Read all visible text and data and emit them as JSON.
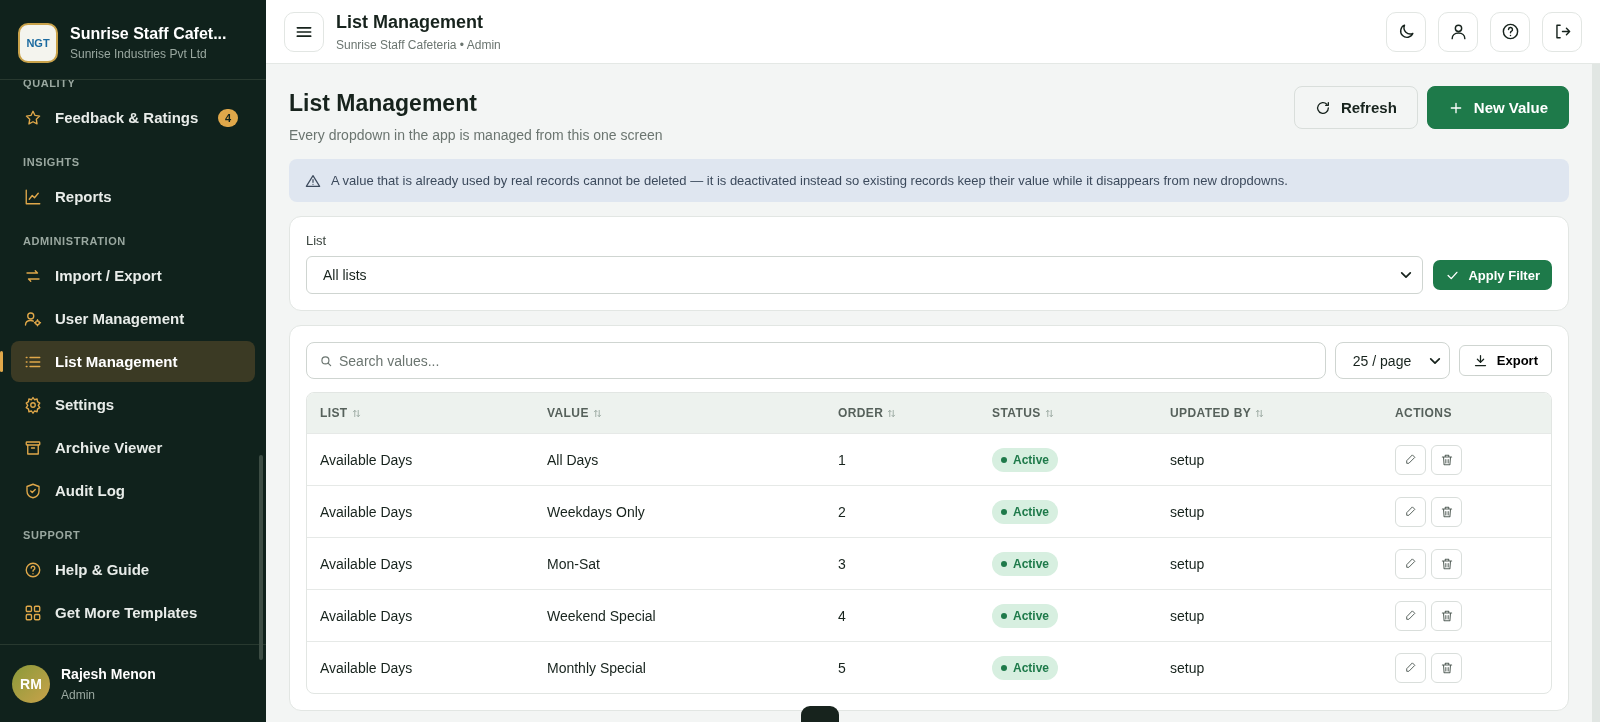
{
  "sidebar": {
    "brand": {
      "logo": "NGT",
      "title": "Sunrise Staff Cafet...",
      "subtitle": "Sunrise Industries Pvt Ltd"
    },
    "sections": [
      {
        "heading": "QUALITY",
        "items": [
          {
            "label": "Feedback & Ratings",
            "badge": "4",
            "selected": false
          }
        ]
      },
      {
        "heading": "INSIGHTS",
        "items": [
          {
            "label": "Reports",
            "selected": false
          }
        ]
      },
      {
        "heading": "ADMINISTRATION",
        "items": [
          {
            "label": "Import / Export",
            "selected": false
          },
          {
            "label": "User Management",
            "selected": false
          },
          {
            "label": "List Management",
            "selected": true
          },
          {
            "label": "Settings",
            "selected": false
          },
          {
            "label": "Archive Viewer",
            "selected": false
          },
          {
            "label": "Audit Log",
            "selected": false
          }
        ]
      },
      {
        "heading": "SUPPORT",
        "items": [
          {
            "label": "Help & Guide",
            "selected": false
          },
          {
            "label": "Get More Templates",
            "selected": false
          }
        ]
      }
    ],
    "user": {
      "initials": "RM",
      "name": "Rajesh Menon",
      "role": "Admin"
    }
  },
  "topbar": {
    "title": "List Management",
    "subtitle": "Sunrise Staff Cafeteria • Admin"
  },
  "page": {
    "title": "List Management",
    "subtitle": "Every dropdown in the app is managed from this one screen",
    "buttons": [
      {
        "kind": "secondary",
        "label": "Refresh"
      },
      {
        "kind": "primary",
        "label": "New Value"
      }
    ],
    "notice": "A value that is already used by real records cannot be deleted — it is deactivated instead so existing records keep their value while it disappears from new dropdowns."
  },
  "filter": {
    "label": "List",
    "value": "All lists",
    "button": "Apply Filter"
  },
  "table": {
    "search_placeholder": "Search values...",
    "page_size": "25 / page",
    "export": "Export",
    "columns": [
      {
        "label": "LIST",
        "sortable": true
      },
      {
        "label": "VALUE",
        "sortable": true
      },
      {
        "label": "ORDER",
        "sortable": true
      },
      {
        "label": "STATUS",
        "sortable": true
      },
      {
        "label": "UPDATED BY",
        "sortable": true
      },
      {
        "label": "ACTIONS",
        "sortable": false
      }
    ],
    "rows": [
      {
        "list": "Available Days",
        "value": "All Days",
        "order": "1",
        "status": "Active",
        "active": true,
        "updated_by": "setup"
      },
      {
        "list": "Available Days",
        "value": "Weekdays Only",
        "order": "2",
        "status": "Active",
        "active": true,
        "updated_by": "setup"
      },
      {
        "list": "Available Days",
        "value": "Mon-Sat",
        "order": "3",
        "status": "Active",
        "active": true,
        "updated_by": "setup"
      },
      {
        "list": "Available Days",
        "value": "Weekend Special",
        "order": "4",
        "status": "Active",
        "active": true,
        "updated_by": "setup"
      },
      {
        "list": "Available Days",
        "value": "Monthly Special",
        "order": "5",
        "status": "Active",
        "active": true,
        "updated_by": "setup"
      }
    ]
  }
}
